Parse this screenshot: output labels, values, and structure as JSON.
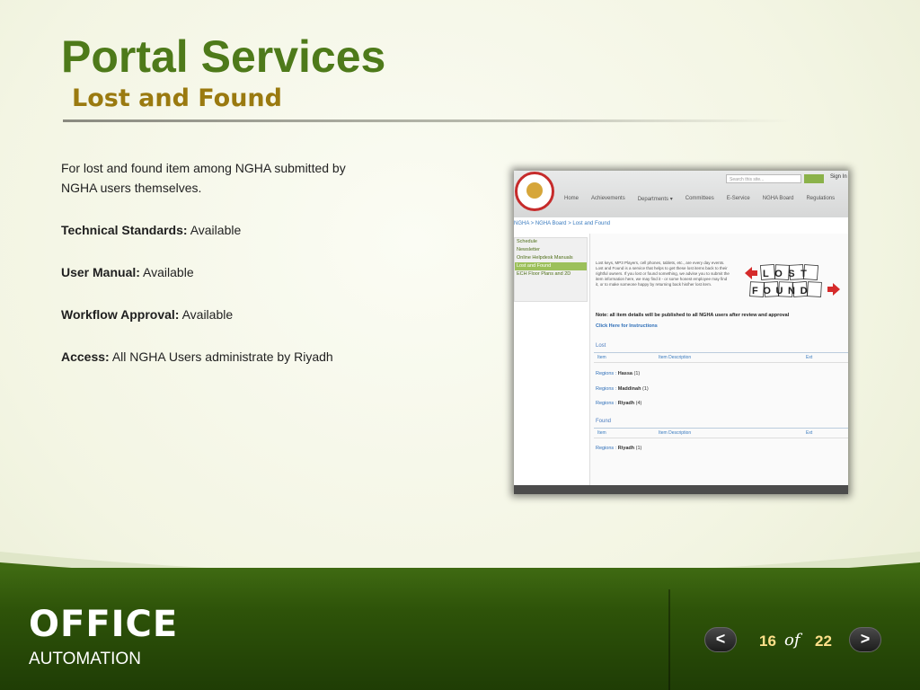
{
  "slide": {
    "title": "Portal Services",
    "subtitle": "Lost and Found",
    "intro": "For lost and found item among NGHA submitted by NGHA users themselves.",
    "fields": [
      {
        "label": "Technical Standards:",
        "value": "Available"
      },
      {
        "label": "User Manual:",
        "value": "Available"
      },
      {
        "label": "Workflow Approval:",
        "value": "Available"
      },
      {
        "label": "Access:",
        "value": "All NGHA Users administrate by Riyadh"
      }
    ]
  },
  "footer": {
    "brand": "OFFICE",
    "brand_sub": "AUTOMATION",
    "prev_icon": "chevron-left-icon",
    "next_icon": "chevron-right-icon",
    "prev_glyph": "<",
    "next_glyph": ">",
    "current_page": "16",
    "of_label": "of",
    "total_pages": "22"
  },
  "screenshot": {
    "search_placeholder": "Search this site...",
    "sign_in": "Sign In",
    "nav": [
      "Home",
      "Achievements",
      "Departments ▾",
      "Committees",
      "E-Service",
      "NGHA Board",
      "Regulations"
    ],
    "breadcrumb": "NGHA > NGHA Board > Lost and Found",
    "side_items": [
      "Schedule",
      "Newsletter",
      "Online Helpdesk Manuals",
      "Lost and Found",
      "ECH Floor Plans and 2D"
    ],
    "description": "Lost keys, MP3 Players, cell phones, tablets, etc., are every day events. Lost and Found is a service that helps to get these lost items back to their rightful owners. If you lost or found something, we advise you to submit the item information here, we may find it - or some honest employee may find it, or to make someone happy by returning back his/her lost item.",
    "lost_word": "LOST",
    "found_word": "FOUND",
    "note": "Note: all item details will be published to all NGHA users after review and approval",
    "instructions_link": "Click Here for Instructions",
    "lost_heading": "Lost",
    "found_heading": "Found",
    "columns": [
      "Item",
      "Item Description",
      "Ext"
    ],
    "lost_rows": [
      {
        "label": "Regions :",
        "name": "Hassa",
        "count": "(1)"
      },
      {
        "label": "Regions :",
        "name": "Maddinah",
        "count": "(1)"
      },
      {
        "label": "Regions :",
        "name": "Riyadh",
        "count": "(4)"
      }
    ],
    "found_rows": [
      {
        "label": "Regions :",
        "name": "Riyadh",
        "count": "(1)"
      }
    ]
  }
}
